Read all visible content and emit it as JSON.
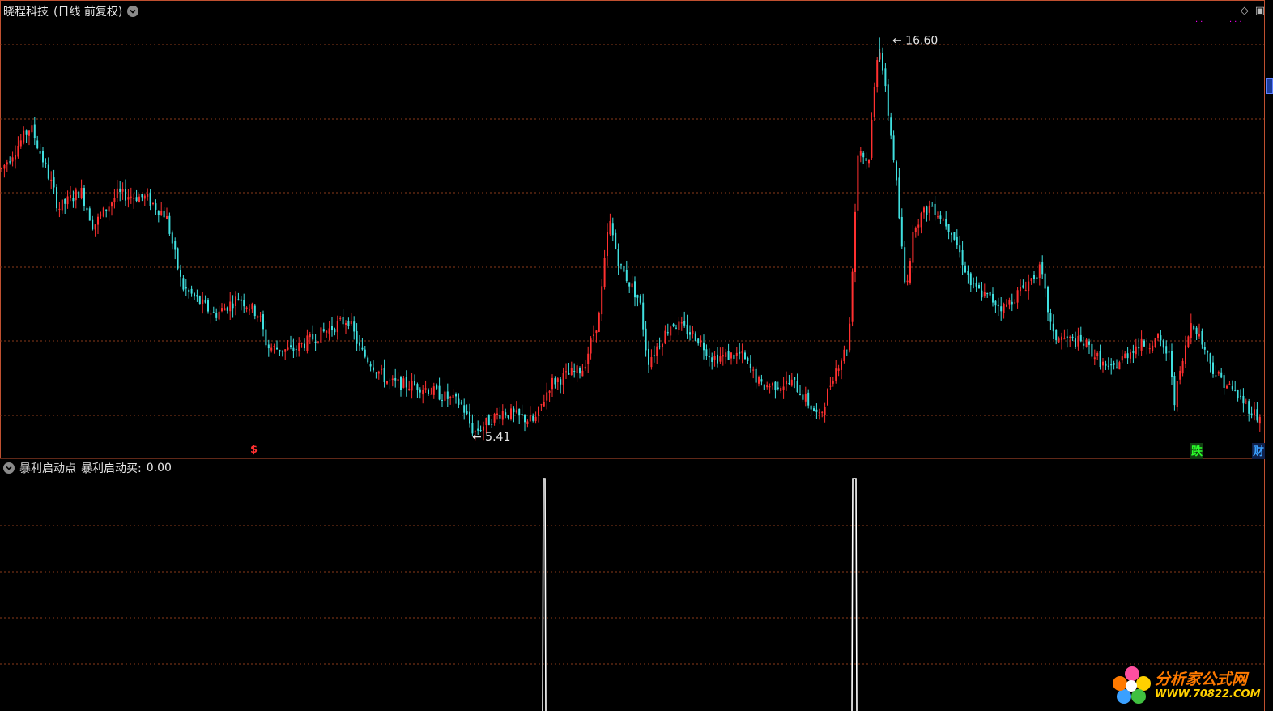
{
  "main_panel": {
    "stock_name": "晓程科技",
    "period_label": "(日线 前复权)",
    "high_label": "16.60",
    "low_label": "5.41",
    "price_range": [
      4.8,
      17.2
    ],
    "markers": {
      "dollar": "$",
      "die": "跌",
      "cai": "财"
    },
    "toolbar_icons": [
      "diamond-icon",
      "window-icon"
    ]
  },
  "indicator_panel": {
    "name": "暴利启动点",
    "line_label": "暴利启动买:",
    "line_value": "0.00"
  },
  "watermark": {
    "site_name": "分析家公式网",
    "site_url": "WWW.70822.COM"
  },
  "colors": {
    "background": "#000000",
    "up_candle": "#ff3030",
    "down_candle": "#40e0e0",
    "grid": "#8a3a1a",
    "panel_border": "#c05030",
    "signal_line": "#ffffff"
  }
}
